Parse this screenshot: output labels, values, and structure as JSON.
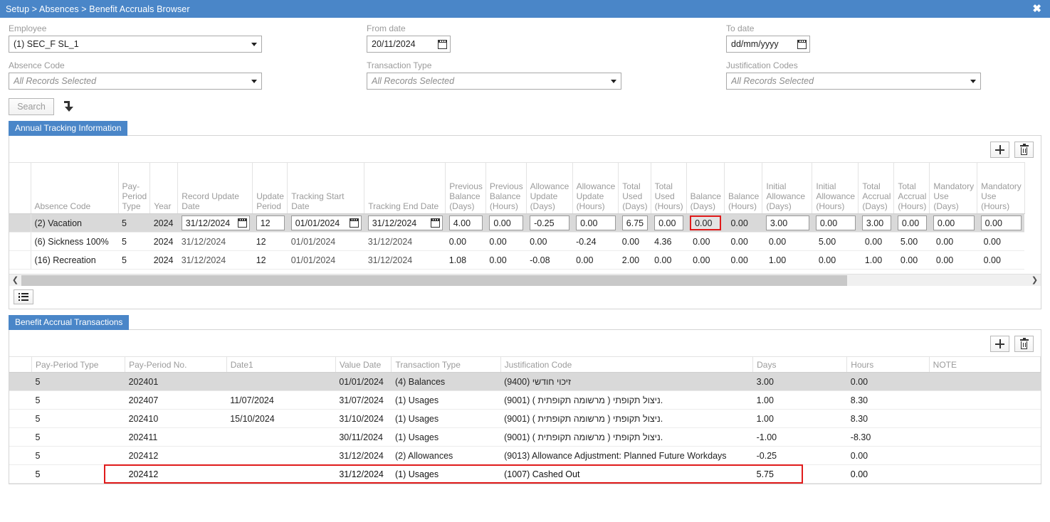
{
  "titlebar": {
    "breadcrumb": "Setup > Absences > Benefit Accruals Browser",
    "close_label": "✖",
    "accent": "#4a86c8"
  },
  "filters": {
    "employee": {
      "label": "Employee",
      "value": "(1) SEC_F SL_1"
    },
    "from_date": {
      "label": "From date",
      "value": "20/11/2024"
    },
    "to_date": {
      "label": "To date",
      "value": "dd/mm/yyyy"
    },
    "absence_code": {
      "label": "Absence Code",
      "value": "All Records Selected"
    },
    "transaction_type": {
      "label": "Transaction Type",
      "value": "All Records Selected"
    },
    "justification_codes": {
      "label": "Justification Codes",
      "value": "All Records Selected"
    },
    "search_button": "Search"
  },
  "section1": {
    "tab_label": "Annual Tracking Information",
    "add_label": "+",
    "columns": [
      "",
      "Absence Code",
      "Pay-Period Type",
      "Year",
      "Record Update Date",
      "Update Period",
      "Tracking Start Date",
      "Tracking End Date",
      "Previous Balance (Days)",
      "Previous Balance (Hours)",
      "Allowance Update (Days)",
      "Allowance Update (Hours)",
      "Total Used (Days)",
      "Total Used (Hours)",
      "Balance (Days)",
      "Balance (Hours)",
      "Initial Allowance (Days)",
      "Initial Allowance (Hours)",
      "Total Accrual (Days)",
      "Total Accrual (Hours)",
      "Mandatory Use (Days)",
      "Mandatory Use (Hours)"
    ],
    "rows": [
      {
        "selected": true,
        "absence_code": "(2) Vacation",
        "pay_period_type": "5",
        "year": "2024",
        "record_update_date": "31/12/2024",
        "update_period": "12",
        "tracking_start_date": "01/01/2024",
        "tracking_end_date": "31/12/2024",
        "prev_balance_days": "4.00",
        "prev_balance_hours": "0.00",
        "allowance_update_days": "-0.25",
        "allowance_update_hours": "0.00",
        "total_used_days": "6.75",
        "total_used_hours": "0.00",
        "balance_days": "0.00",
        "balance_hours": "0.00",
        "initial_allowance_days": "3.00",
        "initial_allowance_hours": "0.00",
        "total_accrual_days": "3.00",
        "total_accrual_hours": "0.00",
        "mandatory_use_days": "0.00",
        "mandatory_use_hours": "0.00"
      },
      {
        "selected": false,
        "absence_code": "(6) Sickness 100%",
        "pay_period_type": "5",
        "year": "2024",
        "record_update_date": "31/12/2024",
        "update_period": "12",
        "tracking_start_date": "01/01/2024",
        "tracking_end_date": "31/12/2024",
        "prev_balance_days": "0.00",
        "prev_balance_hours": "0.00",
        "allowance_update_days": "0.00",
        "allowance_update_hours": "-0.24",
        "total_used_days": "0.00",
        "total_used_hours": "4.36",
        "balance_days": "0.00",
        "balance_hours": "0.00",
        "initial_allowance_days": "0.00",
        "initial_allowance_hours": "5.00",
        "total_accrual_days": "0.00",
        "total_accrual_hours": "5.00",
        "mandatory_use_days": "0.00",
        "mandatory_use_hours": "0.00"
      },
      {
        "selected": false,
        "absence_code": "(16) Recreation",
        "pay_period_type": "5",
        "year": "2024",
        "record_update_date": "31/12/2024",
        "update_period": "12",
        "tracking_start_date": "01/01/2024",
        "tracking_end_date": "31/12/2024",
        "prev_balance_days": "1.08",
        "prev_balance_hours": "0.00",
        "allowance_update_days": "-0.08",
        "allowance_update_hours": "0.00",
        "total_used_days": "2.00",
        "total_used_hours": "0.00",
        "balance_days": "0.00",
        "balance_hours": "0.00",
        "initial_allowance_days": "1.00",
        "initial_allowance_hours": "0.00",
        "total_accrual_days": "1.00",
        "total_accrual_hours": "0.00",
        "mandatory_use_days": "0.00",
        "mandatory_use_hours": "0.00"
      }
    ]
  },
  "section2": {
    "tab_label": "Benefit Accrual Transactions",
    "columns": [
      "",
      "Pay-Period Type",
      "Pay-Period No.",
      "Date1",
      "Value Date",
      "Transaction Type",
      "Justification Code",
      "Days",
      "Hours",
      "NOTE"
    ],
    "rows": [
      {
        "selected": true,
        "highlighted": false,
        "pay_period_type": "5",
        "pay_period_no": "202401",
        "date1": "",
        "value_date": "01/01/2024",
        "transaction_type": "(4) Balances",
        "justification_code": "(9400) זיכוי חודשי",
        "days": "3.00",
        "hours": "0.00",
        "note": ""
      },
      {
        "selected": false,
        "highlighted": false,
        "pay_period_type": "5",
        "pay_period_no": "202407",
        "date1": "11/07/2024",
        "value_date": "31/07/2024",
        "transaction_type": "(1) Usages",
        "justification_code": "(9001) ( מרשומה תקופתית ) ניצול תקופתי.",
        "days": "1.00",
        "hours": "8.30",
        "note": ""
      },
      {
        "selected": false,
        "highlighted": false,
        "pay_period_type": "5",
        "pay_period_no": "202410",
        "date1": "15/10/2024",
        "value_date": "31/10/2024",
        "transaction_type": "(1) Usages",
        "justification_code": "(9001) ( מרשומה תקופתית ) ניצול תקופתי.",
        "days": "1.00",
        "hours": "8.30",
        "note": ""
      },
      {
        "selected": false,
        "highlighted": false,
        "pay_period_type": "5",
        "pay_period_no": "202411",
        "date1": "",
        "value_date": "30/11/2024",
        "transaction_type": "(1) Usages",
        "justification_code": "(9001) ( מרשומה תקופתית ) ניצול תקופתי.",
        "days": "-1.00",
        "hours": "-8.30",
        "note": ""
      },
      {
        "selected": false,
        "highlighted": false,
        "pay_period_type": "5",
        "pay_period_no": "202412",
        "date1": "",
        "value_date": "31/12/2024",
        "transaction_type": "(2) Allowances",
        "justification_code": "(9013) Allowance Adjustment: Planned Future Workdays",
        "days": "-0.25",
        "hours": "0.00",
        "note": ""
      },
      {
        "selected": false,
        "highlighted": true,
        "pay_period_type": "5",
        "pay_period_no": "202412",
        "date1": "",
        "value_date": "31/12/2024",
        "transaction_type": "(1) Usages",
        "justification_code": "(1007) Cashed Out",
        "days": "5.75",
        "hours": "0.00",
        "note": ""
      }
    ]
  }
}
